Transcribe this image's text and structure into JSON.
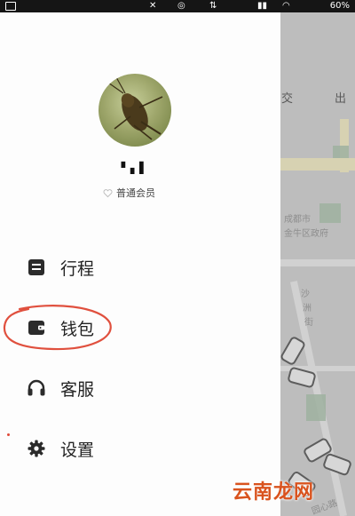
{
  "status_bar": {
    "battery": "60%"
  },
  "map": {
    "tabs": [
      "交",
      "出"
    ],
    "labels": [
      "成都市",
      "金牛区政府",
      "沙",
      "洲",
      "街",
      "园心路"
    ]
  },
  "profile": {
    "name": "▘▖▌",
    "member_level": "普通会员"
  },
  "menu": [
    {
      "label": "行程",
      "icon": "trip-list-icon"
    },
    {
      "label": "钱包",
      "icon": "wallet-icon"
    },
    {
      "label": "客服",
      "icon": "headset-icon"
    },
    {
      "label": "设置",
      "icon": "gear-icon"
    }
  ],
  "watermark": "云南龙网",
  "colors": {
    "highlight_circle": "#e0503e",
    "watermark": "#d9531e",
    "icons": "#2b2b2b"
  }
}
